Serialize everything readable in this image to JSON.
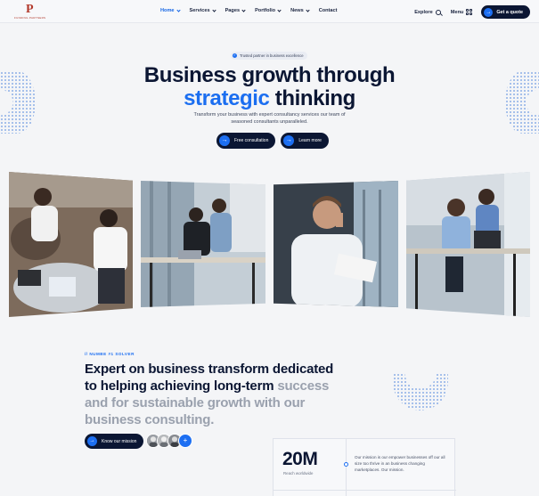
{
  "header": {
    "logo_mark": "P",
    "logo_text": "FUNDING PARTNERS",
    "nav": [
      {
        "label": "Home",
        "active": true,
        "dropdown": true
      },
      {
        "label": "Services",
        "active": false,
        "dropdown": true
      },
      {
        "label": "Pages",
        "active": false,
        "dropdown": true
      },
      {
        "label": "Portfolio",
        "active": false,
        "dropdown": true
      },
      {
        "label": "News",
        "active": false,
        "dropdown": true
      },
      {
        "label": "Contact",
        "active": false,
        "dropdown": false
      }
    ],
    "explore_label": "Explore",
    "menu_label": "Menu",
    "cta_label": "Get a quote"
  },
  "hero": {
    "badge": "Trusted partner in business excellence",
    "title_line1": "Business growth through",
    "title_highlight": "strategic",
    "title_rest": "thinking",
    "subtitle": "Transform your business with expert consultancy services our team of seasoned consultants unparalleled.",
    "btn_primary": "Free consultation",
    "btn_secondary": "Learn more"
  },
  "section2": {
    "eyebrow": "// NUMBE #1 SOLVER",
    "title_main": "Expert on business transform dedicated to helping achieving long-term",
    "title_muted": "success and for sustainable growth with our business consulting.",
    "btn_label": "Know our mission",
    "avatar_plus": "+"
  },
  "stats": {
    "number": "20M",
    "label": "Reach worldwide",
    "description": "Our mission is our empower businesses off our all size too thrive in an business changing marketplaces. Our mission."
  },
  "colors": {
    "accent": "#1d6ff2",
    "navy": "#0b1633",
    "logo": "#b2392b"
  }
}
